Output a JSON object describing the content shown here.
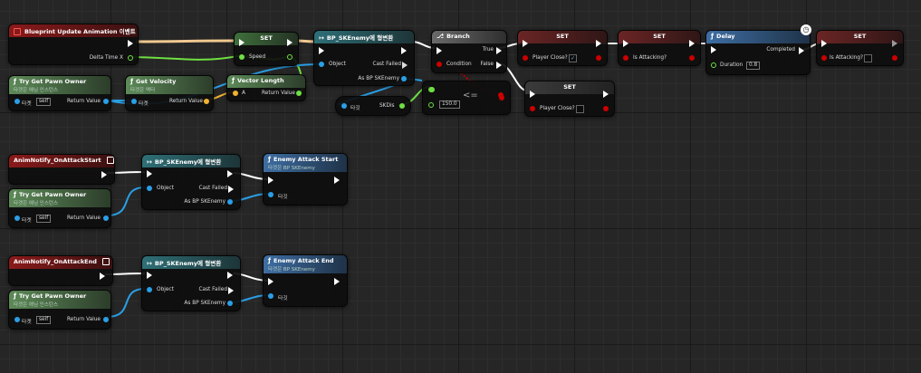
{
  "colors": {
    "exec": "#ffffff",
    "object": "#2a9fe6",
    "float": "#6fe042",
    "bool": "#cc0000",
    "vector": "#f1b232"
  },
  "icons": {
    "function": "function-icon",
    "cast": "cast-icon",
    "branch": "branch-icon",
    "delay": "clock-icon",
    "event": "event-icon"
  },
  "row1": {
    "event": {
      "title": "Blueprint Update Animation 이벤트",
      "pin": "Delta Time X"
    },
    "pawn": {
      "title": "Try Get Pawn Owner",
      "subtitle": "타겟은 애님 인스턴스",
      "target": "타겟",
      "self": "self",
      "ret": "Return Value"
    },
    "velocity": {
      "title": "Get Velocity",
      "subtitle": "타겟은 액터",
      "target": "타겟",
      "ret": "Return Value"
    },
    "vlen": {
      "title": "Vector Length",
      "a": "A",
      "ret": "Return Value"
    },
    "set_speed": {
      "title": "SET",
      "pin": "Speed"
    },
    "cast": {
      "title": "BP_SKEnemy에 형변환",
      "object": "Object",
      "failed": "Cast Failed",
      "as": "As BP SKEnemy"
    },
    "skdis": {
      "target": "타깃",
      "pin": "SKDis"
    },
    "compare": {
      "op": "<=",
      "value": "150.0"
    },
    "branch": {
      "title": "Branch",
      "cond": "Condition",
      "true": "True",
      "false": "False"
    },
    "set1": {
      "title": "SET",
      "pin": "Player Close?",
      "check": "✓"
    },
    "set2": {
      "title": "SET",
      "pin": "Is Attacking?"
    },
    "set3": {
      "title": "SET",
      "pin": "Player Close?"
    },
    "delay": {
      "title": "Delay",
      "completed": "Completed",
      "duration": "Duration",
      "dur_val": "0.8"
    },
    "set4": {
      "title": "SET",
      "pin": "Is Attacking?"
    }
  },
  "row2": {
    "event": {
      "title": "AnimNotify_OnAttackStart"
    },
    "pawn": {
      "title": "Try Get Pawn Owner",
      "subtitle": "타겟은 애님 인스턴스",
      "target": "타겟",
      "self": "self",
      "ret": "Return Value"
    },
    "cast": {
      "title": "BP_SKEnemy에 형변환",
      "object": "Object",
      "failed": "Cast Failed",
      "as": "As BP SKEnemy"
    },
    "call": {
      "title": "Enemy Attack Start",
      "subtitle": "타겟은 BP SKEnemy",
      "target": "타깃"
    }
  },
  "row3": {
    "event": {
      "title": "AnimNotify_OnAttackEnd"
    },
    "pawn": {
      "title": "Try Get Pawn Owner",
      "subtitle": "타겟은 애님 인스턴스",
      "target": "타겟",
      "self": "self",
      "ret": "Return Value"
    },
    "cast": {
      "title": "BP_SKEnemy에 형변환",
      "object": "Object",
      "failed": "Cast Failed",
      "as": "As BP SKEnemy"
    },
    "call": {
      "title": "Enemy Attack End",
      "subtitle": "타겟은 BP SKEnemy",
      "target": "타깃"
    }
  }
}
